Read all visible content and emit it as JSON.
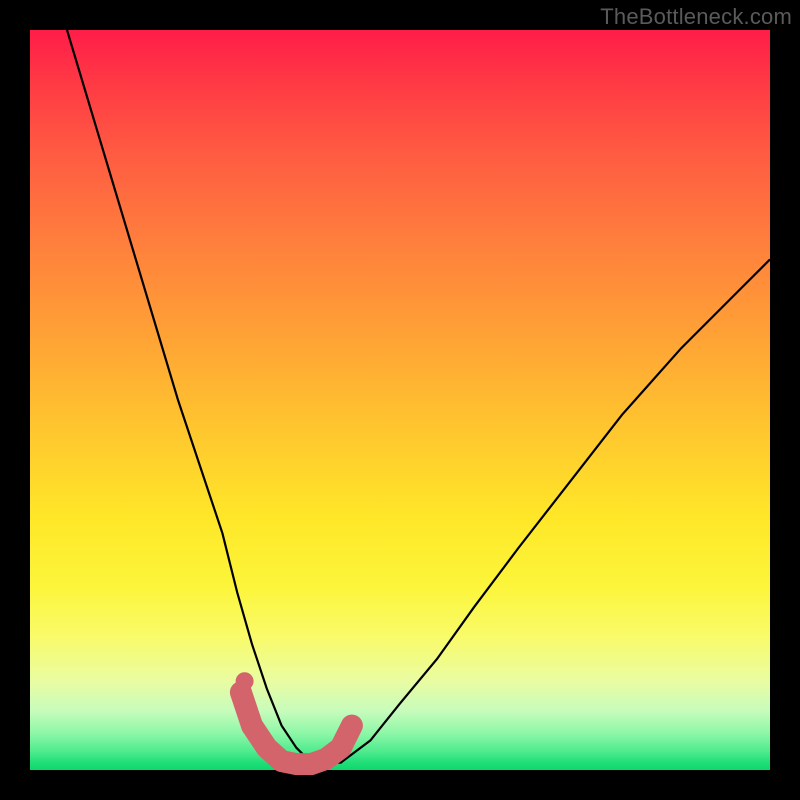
{
  "watermark": "TheBottleneck.com",
  "chart_data": {
    "type": "line",
    "title": "",
    "xlabel": "",
    "ylabel": "",
    "xlim": [
      0,
      100
    ],
    "ylim": [
      0,
      100
    ],
    "series": [
      {
        "name": "bottleneck-curve",
        "x": [
          5,
          8,
          11,
          14,
          17,
          20,
          23,
          26,
          28,
          30,
          32,
          34,
          36,
          38,
          42,
          46,
          50,
          55,
          60,
          66,
          73,
          80,
          88,
          96,
          100
        ],
        "y": [
          100,
          90,
          80,
          70,
          60,
          50,
          41,
          32,
          24,
          17,
          11,
          6,
          3,
          1,
          1,
          4,
          9,
          15,
          22,
          30,
          39,
          48,
          57,
          65,
          69
        ]
      }
    ],
    "highlight_band": {
      "name": "optimal-range",
      "x": [
        28.5,
        30,
        32,
        34,
        36,
        38,
        40,
        42,
        43.5
      ],
      "y": [
        10.5,
        6,
        3,
        1.2,
        0.8,
        0.8,
        1.5,
        3,
        6
      ],
      "color": "#d4646b"
    },
    "highlight_dot": {
      "name": "marker",
      "x": 29,
      "y": 12,
      "color": "#d4646b"
    }
  },
  "colors": {
    "curve": "#000000",
    "highlight": "#d4646b",
    "background_top": "#ff1d49",
    "background_bottom": "#0fd86c",
    "frame": "#000000"
  }
}
